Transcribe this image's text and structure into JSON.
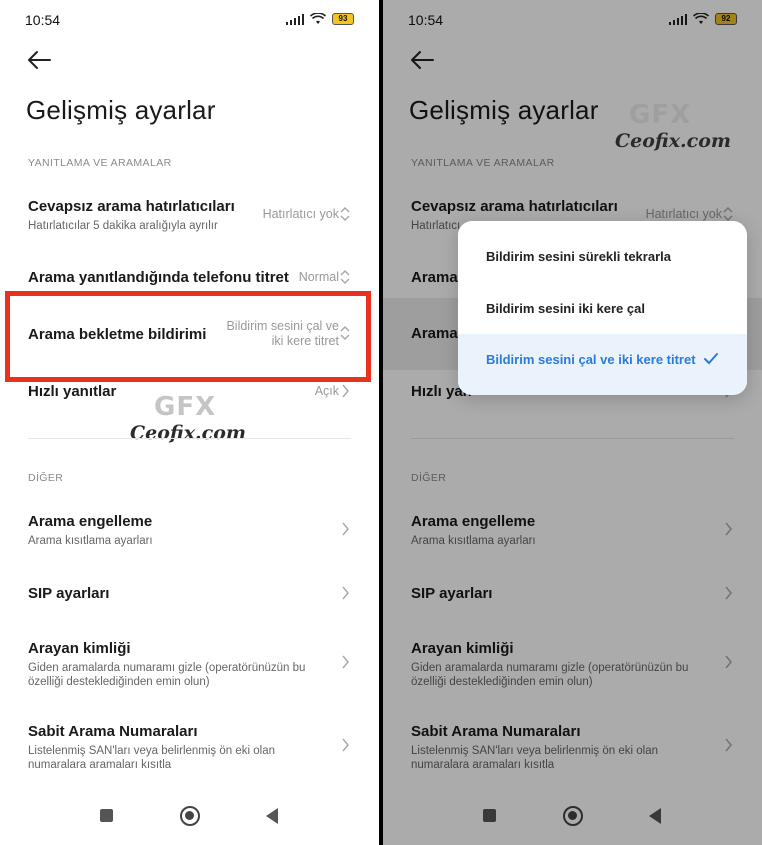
{
  "left": {
    "status": {
      "time": "10:54",
      "battery": "93"
    },
    "title": "Gelişmiş ayarlar",
    "section1": "YANITLAMA VE ARAMALAR",
    "rows1": [
      {
        "title": "Cevapsız arama hatırlatıcıları",
        "subtitle": "Hatırlatıcılar 5 dakika aralığıyla ayrılır",
        "value": "Hatırlatıcı yok"
      },
      {
        "title": "Arama yanıtlandığında telefonu titret",
        "value": "Normal"
      },
      {
        "title": "Arama bekletme bildirimi",
        "value_line1": "Bildirim sesini çal ve",
        "value_line2": "iki kere titret"
      },
      {
        "title": "Hızlı yanıtlar",
        "value": "Açık"
      }
    ],
    "section2": "DİĞER",
    "rows2": [
      {
        "title": "Arama engelleme",
        "subtitle": "Arama kısıtlama ayarları"
      },
      {
        "title": "SIP ayarları"
      },
      {
        "title": "Arayan kimliği",
        "subtitle_line1": "Giden aramalarda numaramı gizle (operatörünüzün bu",
        "subtitle_line2": "özelliği desteklediğinden emin olun)"
      },
      {
        "title": "Sabit Arama Numaraları",
        "subtitle_line1": "Listelenmiş SAN'ları veya belirlenmiş ön eki olan",
        "subtitle_line2": "numaralara aramaları kısıtla"
      }
    ],
    "watermark": {
      "logo": "GFX",
      "text": "Ceofix.com"
    }
  },
  "right": {
    "status": {
      "time": "10:54",
      "battery": "92"
    },
    "title": "Gelişmiş ayarlar",
    "section1": "YANITLAMA VE ARAMALAR",
    "rows1": [
      {
        "title": "Cevapsız arama hatırlatıcıları",
        "subtitle": "Hatırlatıcı",
        "value": "Hatırlatıcı yok"
      },
      {
        "title": "Arama"
      },
      {
        "title": "Arama"
      },
      {
        "title": "Hızlı yan"
      }
    ],
    "section2": "DİĞER",
    "rows2": [
      {
        "title": "Arama engelleme",
        "subtitle": "Arama kısıtlama ayarları"
      },
      {
        "title": "SIP ayarları"
      },
      {
        "title": "Arayan kimliği",
        "subtitle_line1": "Giden aramalarda numaramı gizle (operatörünüzün bu",
        "subtitle_line2": "özelliği desteklediğinden emin olun)"
      },
      {
        "title": "Sabit Arama Numaraları",
        "subtitle_line1": "Listelenmiş SAN'ları veya belirlenmiş ön eki olan",
        "subtitle_line2": "numaralara aramaları kısıtla"
      }
    ],
    "popup": {
      "options": [
        "Bildirim sesini sürekli tekrarla",
        "Bildirim sesini iki kere çal",
        "Bildirim sesini çal ve iki kere titret"
      ],
      "selected_index": 2
    },
    "watermark": {
      "logo": "GFX",
      "text": "Ceofix.com"
    }
  },
  "colors": {
    "highlight_border": "#e8311f",
    "selected_text": "#2b7bd8",
    "selected_bg": "#eaf2fb"
  }
}
